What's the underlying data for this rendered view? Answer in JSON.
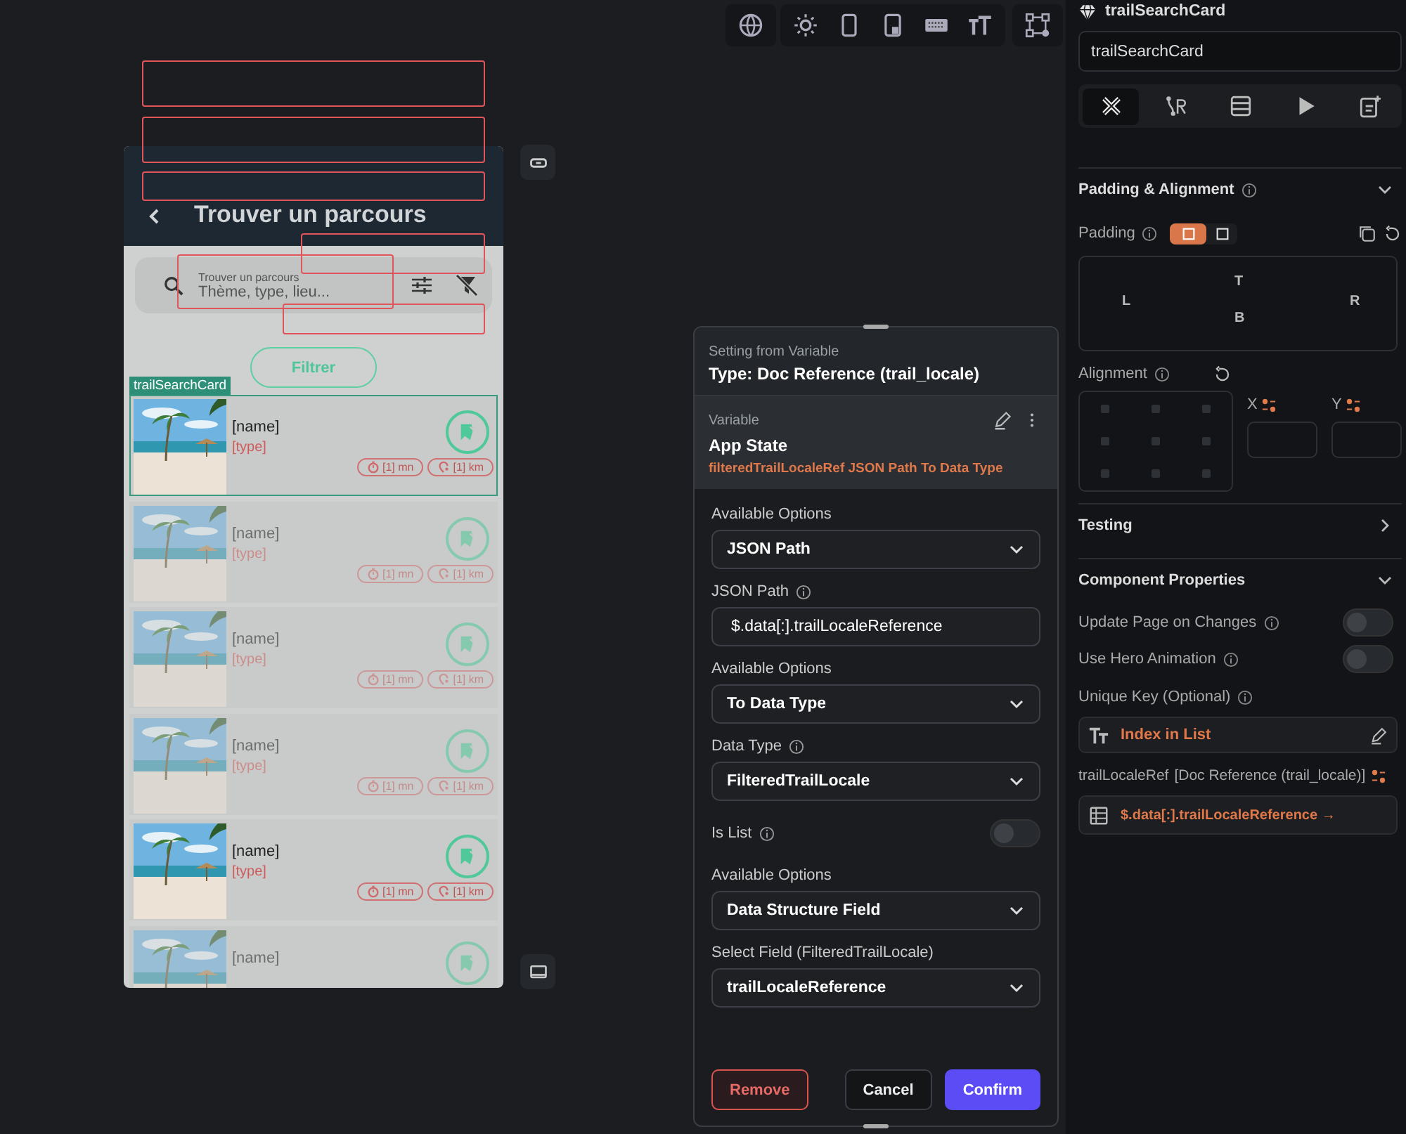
{
  "phone": {
    "title": "Trouver un parcours",
    "search": {
      "label": "Trouver un parcours",
      "placeholder": "Thème, type, lieu..."
    },
    "filter_button": "Filtrer",
    "card_tag": "trailSearchCard",
    "cards": [
      {
        "name": "[name]",
        "type": "[type]",
        "duration": "[1] mn",
        "distance": "[1] km",
        "selected": true,
        "dimmed": false
      },
      {
        "name": "[name]",
        "type": "[type]",
        "duration": "[1] mn",
        "distance": "[1] km",
        "selected": false,
        "dimmed": true
      },
      {
        "name": "[name]",
        "type": "[type]",
        "duration": "[1] mn",
        "distance": "[1] km",
        "selected": false,
        "dimmed": true
      },
      {
        "name": "[name]",
        "type": "[type]",
        "duration": "[1] mn",
        "distance": "[1] km",
        "selected": false,
        "dimmed": true
      },
      {
        "name": "[name]",
        "type": "[type]",
        "duration": "[1] mn",
        "distance": "[1] km",
        "selected": false,
        "dimmed": false
      },
      {
        "name": "[name]",
        "selected": false,
        "dimmed": true
      }
    ]
  },
  "dialog": {
    "heading": "Setting from Variable",
    "type": "Type: Doc Reference (trail_locale)",
    "variable": {
      "label": "Variable",
      "source": "App State",
      "path": "filteredTrailLocaleRef JSON Path To Data Type"
    },
    "fields": [
      {
        "kind": "select",
        "label": "Available Options",
        "info": false,
        "value": "JSON Path"
      },
      {
        "kind": "input",
        "label": "JSON Path",
        "info": true,
        "value": "$.data[:].trailLocaleReference"
      },
      {
        "kind": "select",
        "label": "Available Options",
        "info": false,
        "value": "To Data Type"
      },
      {
        "kind": "select",
        "label": "Data Type",
        "info": true,
        "value": "FilteredTrailLocale"
      },
      {
        "kind": "toggle",
        "label": "Is List",
        "info": true,
        "on": false
      },
      {
        "kind": "select",
        "label": "Available Options",
        "info": false,
        "value": "Data Structure Field"
      },
      {
        "kind": "select",
        "label": "Select Field (FilteredTrailLocale)",
        "info": false,
        "value": "trailLocaleReference"
      }
    ],
    "buttons": [
      {
        "label": "Remove",
        "kind": "danger"
      },
      {
        "label": "Cancel",
        "kind": "secondary"
      },
      {
        "label": "Confirm",
        "kind": "primary"
      }
    ]
  },
  "panel": {
    "title": "trailSearchCard",
    "name_value": "trailSearchCard",
    "tabs": [
      {
        "kind": "design",
        "selected": true
      },
      {
        "kind": "actions",
        "selected": false
      },
      {
        "kind": "backend",
        "selected": false
      },
      {
        "kind": "run",
        "selected": false
      },
      {
        "kind": "notes",
        "selected": false
      }
    ],
    "padding_section": {
      "title": "Padding & Alignment",
      "expanded": true,
      "padding_label": "Padding",
      "top": "T",
      "left": "L",
      "right": "R",
      "bottom": "B",
      "alignment_label": "Alignment",
      "x_label": "X",
      "y_label": "Y"
    },
    "testing_section": {
      "title": "Testing",
      "expanded": false
    },
    "properties_section": {
      "title": "Component Properties",
      "expanded": true,
      "toggles": [
        {
          "label": "Update Page on Changes",
          "on": false
        },
        {
          "label": "Use Hero Animation",
          "on": false
        }
      ],
      "unique_key_label": "Unique Key (Optional)",
      "unique_key_value": "Index in List",
      "param_name": "trailLocaleRef",
      "param_type": "[Doc Reference (trail_locale)]",
      "param_value": "$.data[:].trailLocaleReference →"
    }
  }
}
